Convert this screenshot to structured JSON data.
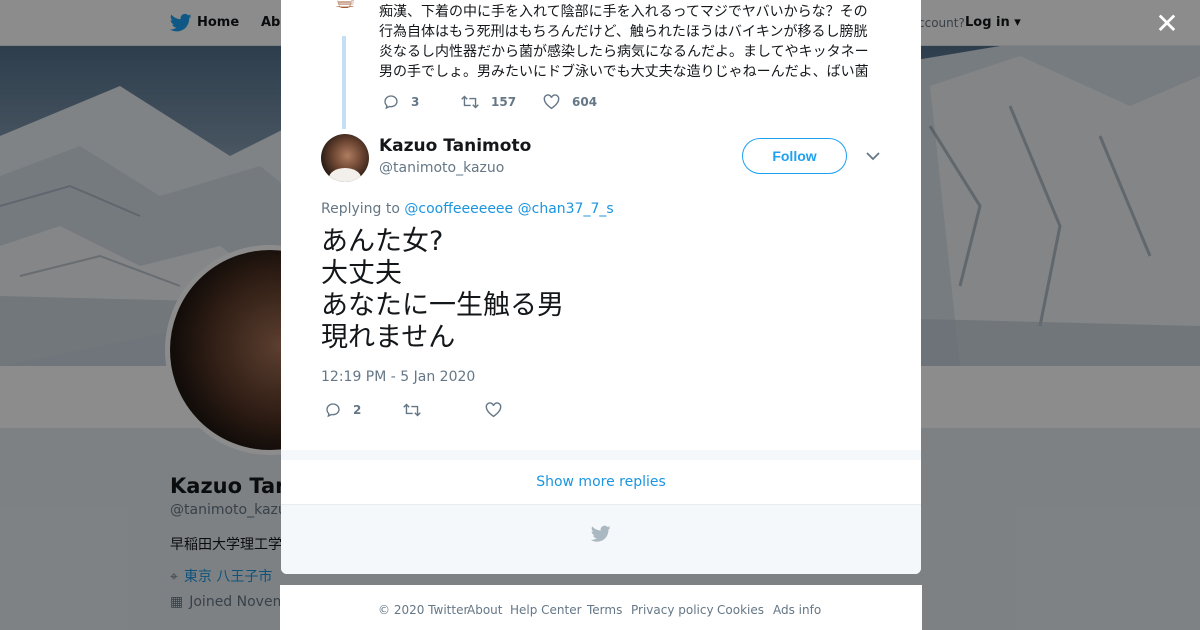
{
  "topnav": {
    "home": "Home",
    "about": "Abo",
    "account_prompt": "ccount?",
    "login": "Log in"
  },
  "profile": {
    "name": "Kazuo Tani",
    "handle": "@tanimoto_kazuo",
    "bio": "早稲田大学理工学",
    "location": "東京 八王子市",
    "joined": "Joined Novem"
  },
  "previous_tweet": {
    "text": "痴漢、下着の中に手を入れて陰部に手を入れるってマジでヤバいからな？その行為自体はもう死刑はもちろんだけど、触られたほうはバイキンが移るし膀胱炎なるし内性器だから菌が感染したら病気になるんだよ。ましてやキッタネー男の手でしょ。男みたいにドブ泳いでも大丈夫な造りじゃねーんだよ、ばい菌",
    "replies": "3",
    "retweets": "157",
    "likes": "604"
  },
  "tweet": {
    "name": "Kazuo Tanimoto",
    "handle": "@tanimoto_kazuo",
    "follow_label": "Follow",
    "replying_prefix": "Replying to ",
    "reply_to": [
      "@cooffeeeeeee",
      "@chan37_7_s"
    ],
    "body_lines": [
      "あんた女?",
      "大丈夫",
      "あなたに一生触る男",
      "現れません"
    ],
    "timestamp": "12:19 PM - 5 Jan 2020",
    "replies": "2",
    "retweets": "",
    "likes": ""
  },
  "show_more": "Show more replies",
  "footer": {
    "links": [
      "© 2020 Twitter",
      "About",
      "Help Center",
      "Terms",
      "Privacy policy",
      "Cookies",
      "Ads info"
    ]
  },
  "colors": {
    "accent": "#1da1f2",
    "link": "#1b95e0",
    "muted": "#657786",
    "text": "#14171a"
  },
  "icons": {
    "close": "close-icon",
    "twitter": "twitter-bird-icon",
    "reply": "reply-icon",
    "retweet": "retweet-icon",
    "like": "heart-icon",
    "more": "chevron-down-icon",
    "location": "location-pin-icon",
    "calendar": "calendar-icon"
  }
}
